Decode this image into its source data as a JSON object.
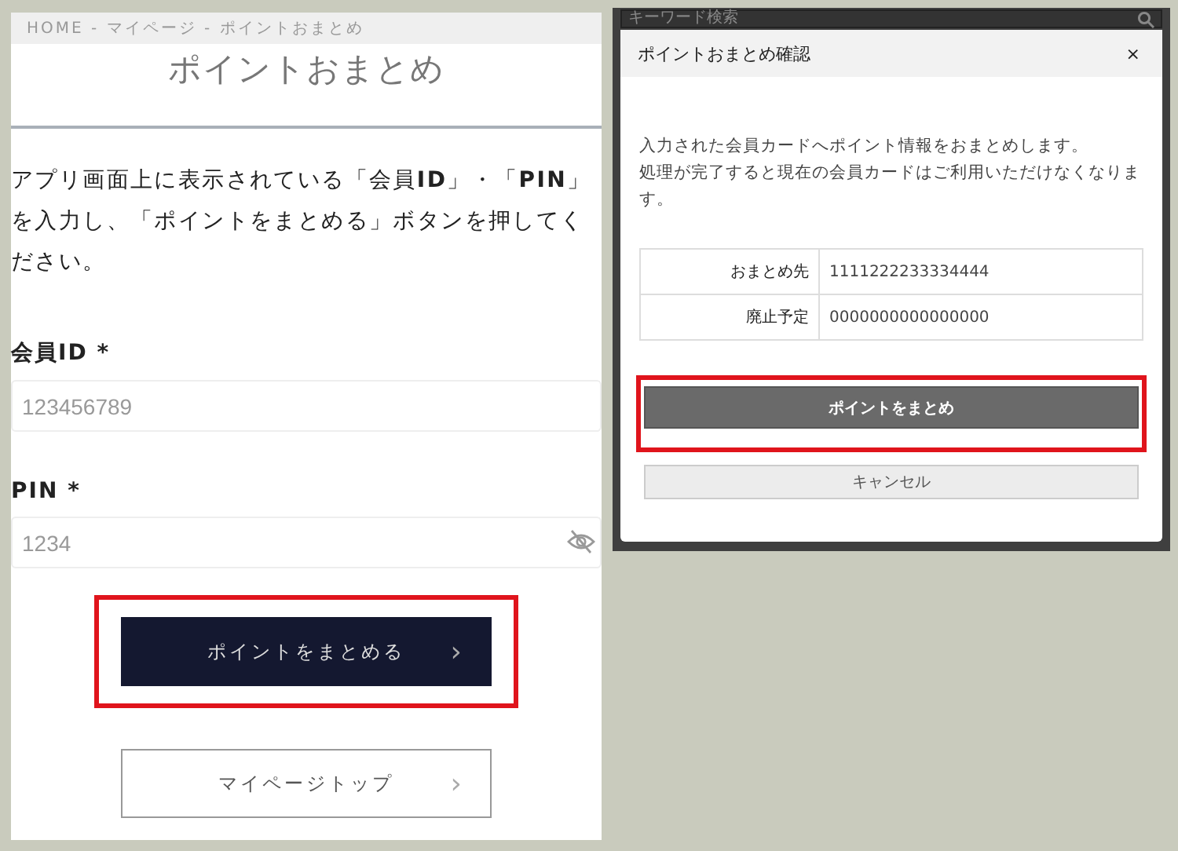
{
  "form_page": {
    "breadcrumb": "HOME - マイページ - ポイントおまとめ",
    "title": "ポイントおまとめ",
    "instructions": "アプリ画面上に表示されている「会員**ID**」・「**PIN**」を入力し、「ポイントをまとめる」ボタンを押してください。",
    "fields": [
      {
        "label": "会員ID",
        "required_mark": "*",
        "placeholder": "123456789",
        "kind": "text"
      },
      {
        "label": "PIN",
        "required_mark": "*",
        "placeholder": "1234",
        "kind": "password"
      }
    ],
    "buttons": [
      {
        "label": "ポイントをまとめる",
        "chevron": "›",
        "kind": "primary",
        "highlighted": true
      },
      {
        "label": "マイページトップ",
        "chevron": "›",
        "kind": "outline",
        "highlighted": false
      }
    ]
  },
  "confirm_screen": {
    "search": {
      "placeholder": "キーワード検索"
    },
    "dialog": {
      "title": "ポイントおまとめ確認",
      "close": "×",
      "message_lines": [
        "入力された会員カードへポイント情報をおまとめします。",
        "処理が完了すると現在の会員カードはご利用いただけなくなります。"
      ],
      "rows": [
        {
          "label": "おまとめ先",
          "value": "1111222233334444"
        },
        {
          "label": "廃止予定",
          "value": "0000000000000000"
        }
      ],
      "buttons": [
        {
          "label": "ポイントをまとめ",
          "kind": "primary",
          "highlighted": true
        },
        {
          "label": "キャンセル",
          "kind": "secondary",
          "highlighted": false
        }
      ]
    }
  }
}
